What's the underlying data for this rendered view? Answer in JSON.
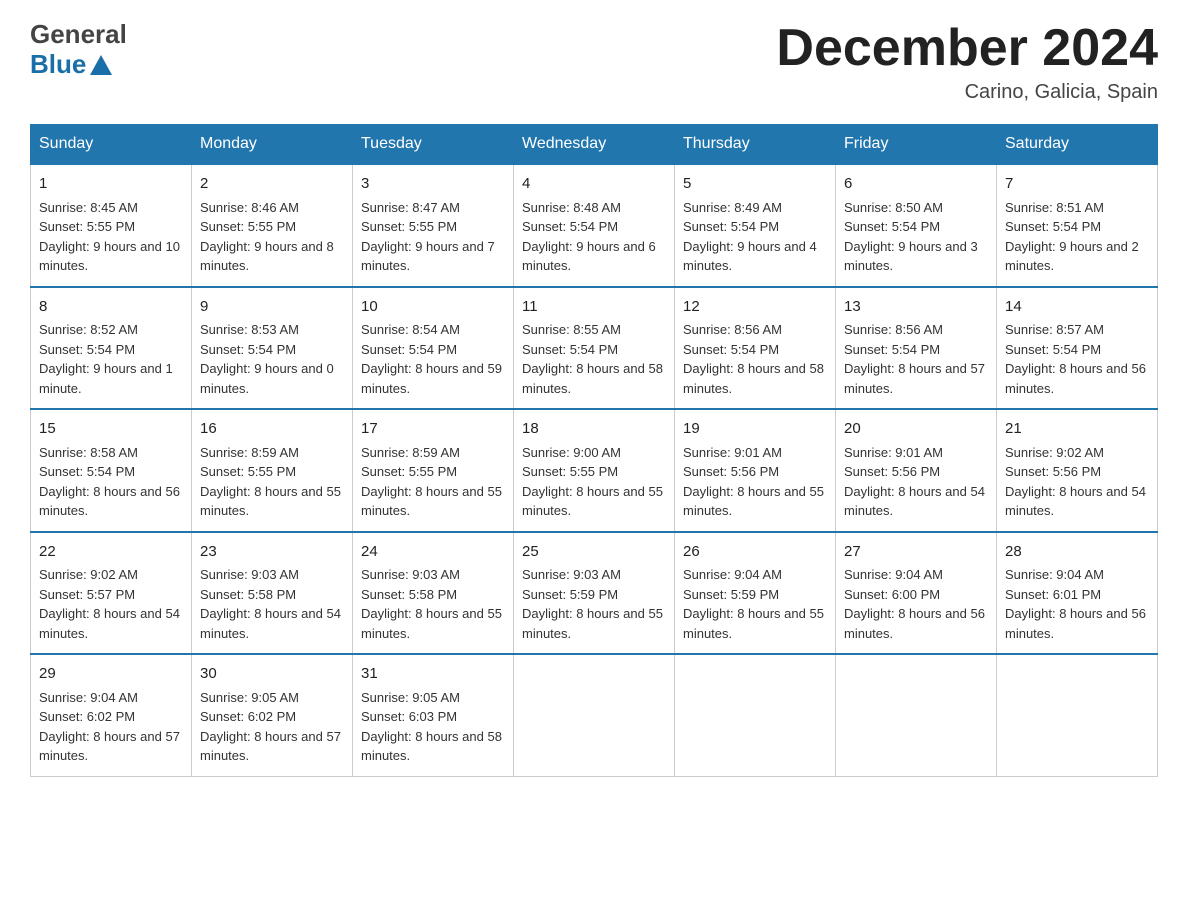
{
  "header": {
    "logo_line1": "General",
    "logo_line2": "Blue",
    "month_title": "December 2024",
    "location": "Carino, Galicia, Spain"
  },
  "days_of_week": [
    "Sunday",
    "Monday",
    "Tuesday",
    "Wednesday",
    "Thursday",
    "Friday",
    "Saturday"
  ],
  "weeks": [
    [
      {
        "day": "1",
        "sunrise": "8:45 AM",
        "sunset": "5:55 PM",
        "daylight": "9 hours and 10 minutes."
      },
      {
        "day": "2",
        "sunrise": "8:46 AM",
        "sunset": "5:55 PM",
        "daylight": "9 hours and 8 minutes."
      },
      {
        "day": "3",
        "sunrise": "8:47 AM",
        "sunset": "5:55 PM",
        "daylight": "9 hours and 7 minutes."
      },
      {
        "day": "4",
        "sunrise": "8:48 AM",
        "sunset": "5:54 PM",
        "daylight": "9 hours and 6 minutes."
      },
      {
        "day": "5",
        "sunrise": "8:49 AM",
        "sunset": "5:54 PM",
        "daylight": "9 hours and 4 minutes."
      },
      {
        "day": "6",
        "sunrise": "8:50 AM",
        "sunset": "5:54 PM",
        "daylight": "9 hours and 3 minutes."
      },
      {
        "day": "7",
        "sunrise": "8:51 AM",
        "sunset": "5:54 PM",
        "daylight": "9 hours and 2 minutes."
      }
    ],
    [
      {
        "day": "8",
        "sunrise": "8:52 AM",
        "sunset": "5:54 PM",
        "daylight": "9 hours and 1 minute."
      },
      {
        "day": "9",
        "sunrise": "8:53 AM",
        "sunset": "5:54 PM",
        "daylight": "9 hours and 0 minutes."
      },
      {
        "day": "10",
        "sunrise": "8:54 AM",
        "sunset": "5:54 PM",
        "daylight": "8 hours and 59 minutes."
      },
      {
        "day": "11",
        "sunrise": "8:55 AM",
        "sunset": "5:54 PM",
        "daylight": "8 hours and 58 minutes."
      },
      {
        "day": "12",
        "sunrise": "8:56 AM",
        "sunset": "5:54 PM",
        "daylight": "8 hours and 58 minutes."
      },
      {
        "day": "13",
        "sunrise": "8:56 AM",
        "sunset": "5:54 PM",
        "daylight": "8 hours and 57 minutes."
      },
      {
        "day": "14",
        "sunrise": "8:57 AM",
        "sunset": "5:54 PM",
        "daylight": "8 hours and 56 minutes."
      }
    ],
    [
      {
        "day": "15",
        "sunrise": "8:58 AM",
        "sunset": "5:54 PM",
        "daylight": "8 hours and 56 minutes."
      },
      {
        "day": "16",
        "sunrise": "8:59 AM",
        "sunset": "5:55 PM",
        "daylight": "8 hours and 55 minutes."
      },
      {
        "day": "17",
        "sunrise": "8:59 AM",
        "sunset": "5:55 PM",
        "daylight": "8 hours and 55 minutes."
      },
      {
        "day": "18",
        "sunrise": "9:00 AM",
        "sunset": "5:55 PM",
        "daylight": "8 hours and 55 minutes."
      },
      {
        "day": "19",
        "sunrise": "9:01 AM",
        "sunset": "5:56 PM",
        "daylight": "8 hours and 55 minutes."
      },
      {
        "day": "20",
        "sunrise": "9:01 AM",
        "sunset": "5:56 PM",
        "daylight": "8 hours and 54 minutes."
      },
      {
        "day": "21",
        "sunrise": "9:02 AM",
        "sunset": "5:56 PM",
        "daylight": "8 hours and 54 minutes."
      }
    ],
    [
      {
        "day": "22",
        "sunrise": "9:02 AM",
        "sunset": "5:57 PM",
        "daylight": "8 hours and 54 minutes."
      },
      {
        "day": "23",
        "sunrise": "9:03 AM",
        "sunset": "5:58 PM",
        "daylight": "8 hours and 54 minutes."
      },
      {
        "day": "24",
        "sunrise": "9:03 AM",
        "sunset": "5:58 PM",
        "daylight": "8 hours and 55 minutes."
      },
      {
        "day": "25",
        "sunrise": "9:03 AM",
        "sunset": "5:59 PM",
        "daylight": "8 hours and 55 minutes."
      },
      {
        "day": "26",
        "sunrise": "9:04 AM",
        "sunset": "5:59 PM",
        "daylight": "8 hours and 55 minutes."
      },
      {
        "day": "27",
        "sunrise": "9:04 AM",
        "sunset": "6:00 PM",
        "daylight": "8 hours and 56 minutes."
      },
      {
        "day": "28",
        "sunrise": "9:04 AM",
        "sunset": "6:01 PM",
        "daylight": "8 hours and 56 minutes."
      }
    ],
    [
      {
        "day": "29",
        "sunrise": "9:04 AM",
        "sunset": "6:02 PM",
        "daylight": "8 hours and 57 minutes."
      },
      {
        "day": "30",
        "sunrise": "9:05 AM",
        "sunset": "6:02 PM",
        "daylight": "8 hours and 57 minutes."
      },
      {
        "day": "31",
        "sunrise": "9:05 AM",
        "sunset": "6:03 PM",
        "daylight": "8 hours and 58 minutes."
      },
      null,
      null,
      null,
      null
    ]
  ],
  "labels": {
    "sunrise": "Sunrise:",
    "sunset": "Sunset:",
    "daylight": "Daylight:"
  }
}
